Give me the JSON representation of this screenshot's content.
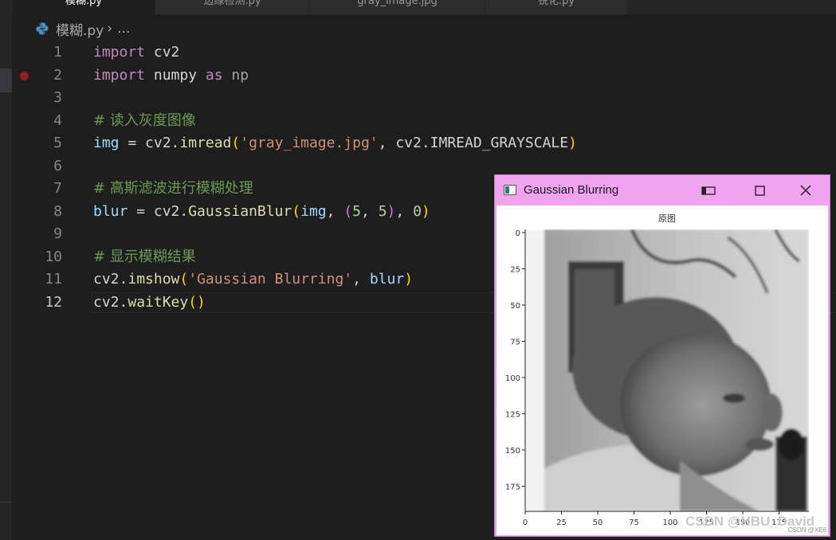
{
  "tabs": [
    {
      "label": "模糊.py",
      "active": true
    },
    {
      "label": "边缘检测.py",
      "active": false
    },
    {
      "label": "gray_image.jpg",
      "active": false
    },
    {
      "label": "锐化.py",
      "active": false
    }
  ],
  "breadcrumb": {
    "file": "模糊.py",
    "rest": "..."
  },
  "editor": {
    "current_line": 12,
    "breakpoint_line": 2,
    "lines": [
      {
        "n": "1",
        "tokens": [
          {
            "t": "import",
            "c": "kw"
          },
          {
            "t": " cv2",
            "c": "id"
          }
        ]
      },
      {
        "n": "2",
        "tokens": [
          {
            "t": "import",
            "c": "kw"
          },
          {
            "t": " numpy ",
            "c": "id"
          },
          {
            "t": "as",
            "c": "kw"
          },
          {
            "t": " np",
            "c": "dim"
          }
        ]
      },
      {
        "n": "3",
        "tokens": []
      },
      {
        "n": "4",
        "tokens": [
          {
            "t": "# 读入灰度图像",
            "c": "cm"
          }
        ]
      },
      {
        "n": "5",
        "tokens": [
          {
            "t": "img",
            "c": "var"
          },
          {
            "t": " = cv2.",
            "c": "id"
          },
          {
            "t": "imread",
            "c": "fn"
          },
          {
            "t": "(",
            "c": "p1"
          },
          {
            "t": "'gray_image.jpg'",
            "c": "str"
          },
          {
            "t": ", cv2.IMREAD_GRAYSCALE",
            "c": "id"
          },
          {
            "t": ")",
            "c": "p1"
          }
        ]
      },
      {
        "n": "6",
        "tokens": []
      },
      {
        "n": "7",
        "tokens": [
          {
            "t": "# 高斯滤波进行模糊处理",
            "c": "cm"
          }
        ]
      },
      {
        "n": "8",
        "tokens": [
          {
            "t": "blur",
            "c": "var"
          },
          {
            "t": " = cv2.",
            "c": "id"
          },
          {
            "t": "GaussianBlur",
            "c": "fn"
          },
          {
            "t": "(",
            "c": "p1"
          },
          {
            "t": "img",
            "c": "var"
          },
          {
            "t": ", ",
            "c": "id"
          },
          {
            "t": "(",
            "c": "p2"
          },
          {
            "t": "5",
            "c": "num"
          },
          {
            "t": ", ",
            "c": "id"
          },
          {
            "t": "5",
            "c": "num"
          },
          {
            "t": ")",
            "c": "p2"
          },
          {
            "t": ", ",
            "c": "id"
          },
          {
            "t": "0",
            "c": "num"
          },
          {
            "t": ")",
            "c": "p1"
          }
        ]
      },
      {
        "n": "9",
        "tokens": []
      },
      {
        "n": "10",
        "tokens": [
          {
            "t": "# 显示模糊结果",
            "c": "cm"
          }
        ]
      },
      {
        "n": "11",
        "tokens": [
          {
            "t": "cv2.",
            "c": "id"
          },
          {
            "t": "imshow",
            "c": "fn"
          },
          {
            "t": "(",
            "c": "p1"
          },
          {
            "t": "'Gaussian Blurring'",
            "c": "str"
          },
          {
            "t": ", ",
            "c": "id"
          },
          {
            "t": "blur",
            "c": "var"
          },
          {
            "t": ")",
            "c": "p1"
          }
        ]
      },
      {
        "n": "12",
        "tokens": [
          {
            "t": "cv2.",
            "c": "id"
          },
          {
            "t": "waitKey",
            "c": "fn"
          },
          {
            "t": "()",
            "c": "p1"
          }
        ]
      }
    ]
  },
  "window": {
    "title": "Gaussian Blurring",
    "icons": {
      "minimize": "minimize-icon",
      "maximize": "maximize-icon",
      "close": "close-icon"
    },
    "plot": {
      "title": "原图",
      "y_ticks": [
        "0",
        "25",
        "50",
        "75",
        "100",
        "125",
        "150",
        "175"
      ],
      "x_ticks": [
        "0",
        "25",
        "50",
        "75",
        "100",
        "125",
        "150",
        "175"
      ]
    },
    "watermark": "CSDN @HBU_David",
    "credit": "CSDN @XE6"
  },
  "colors": {
    "accent_window": "#f0a3ef",
    "editor_bg": "#1e1e1e"
  }
}
